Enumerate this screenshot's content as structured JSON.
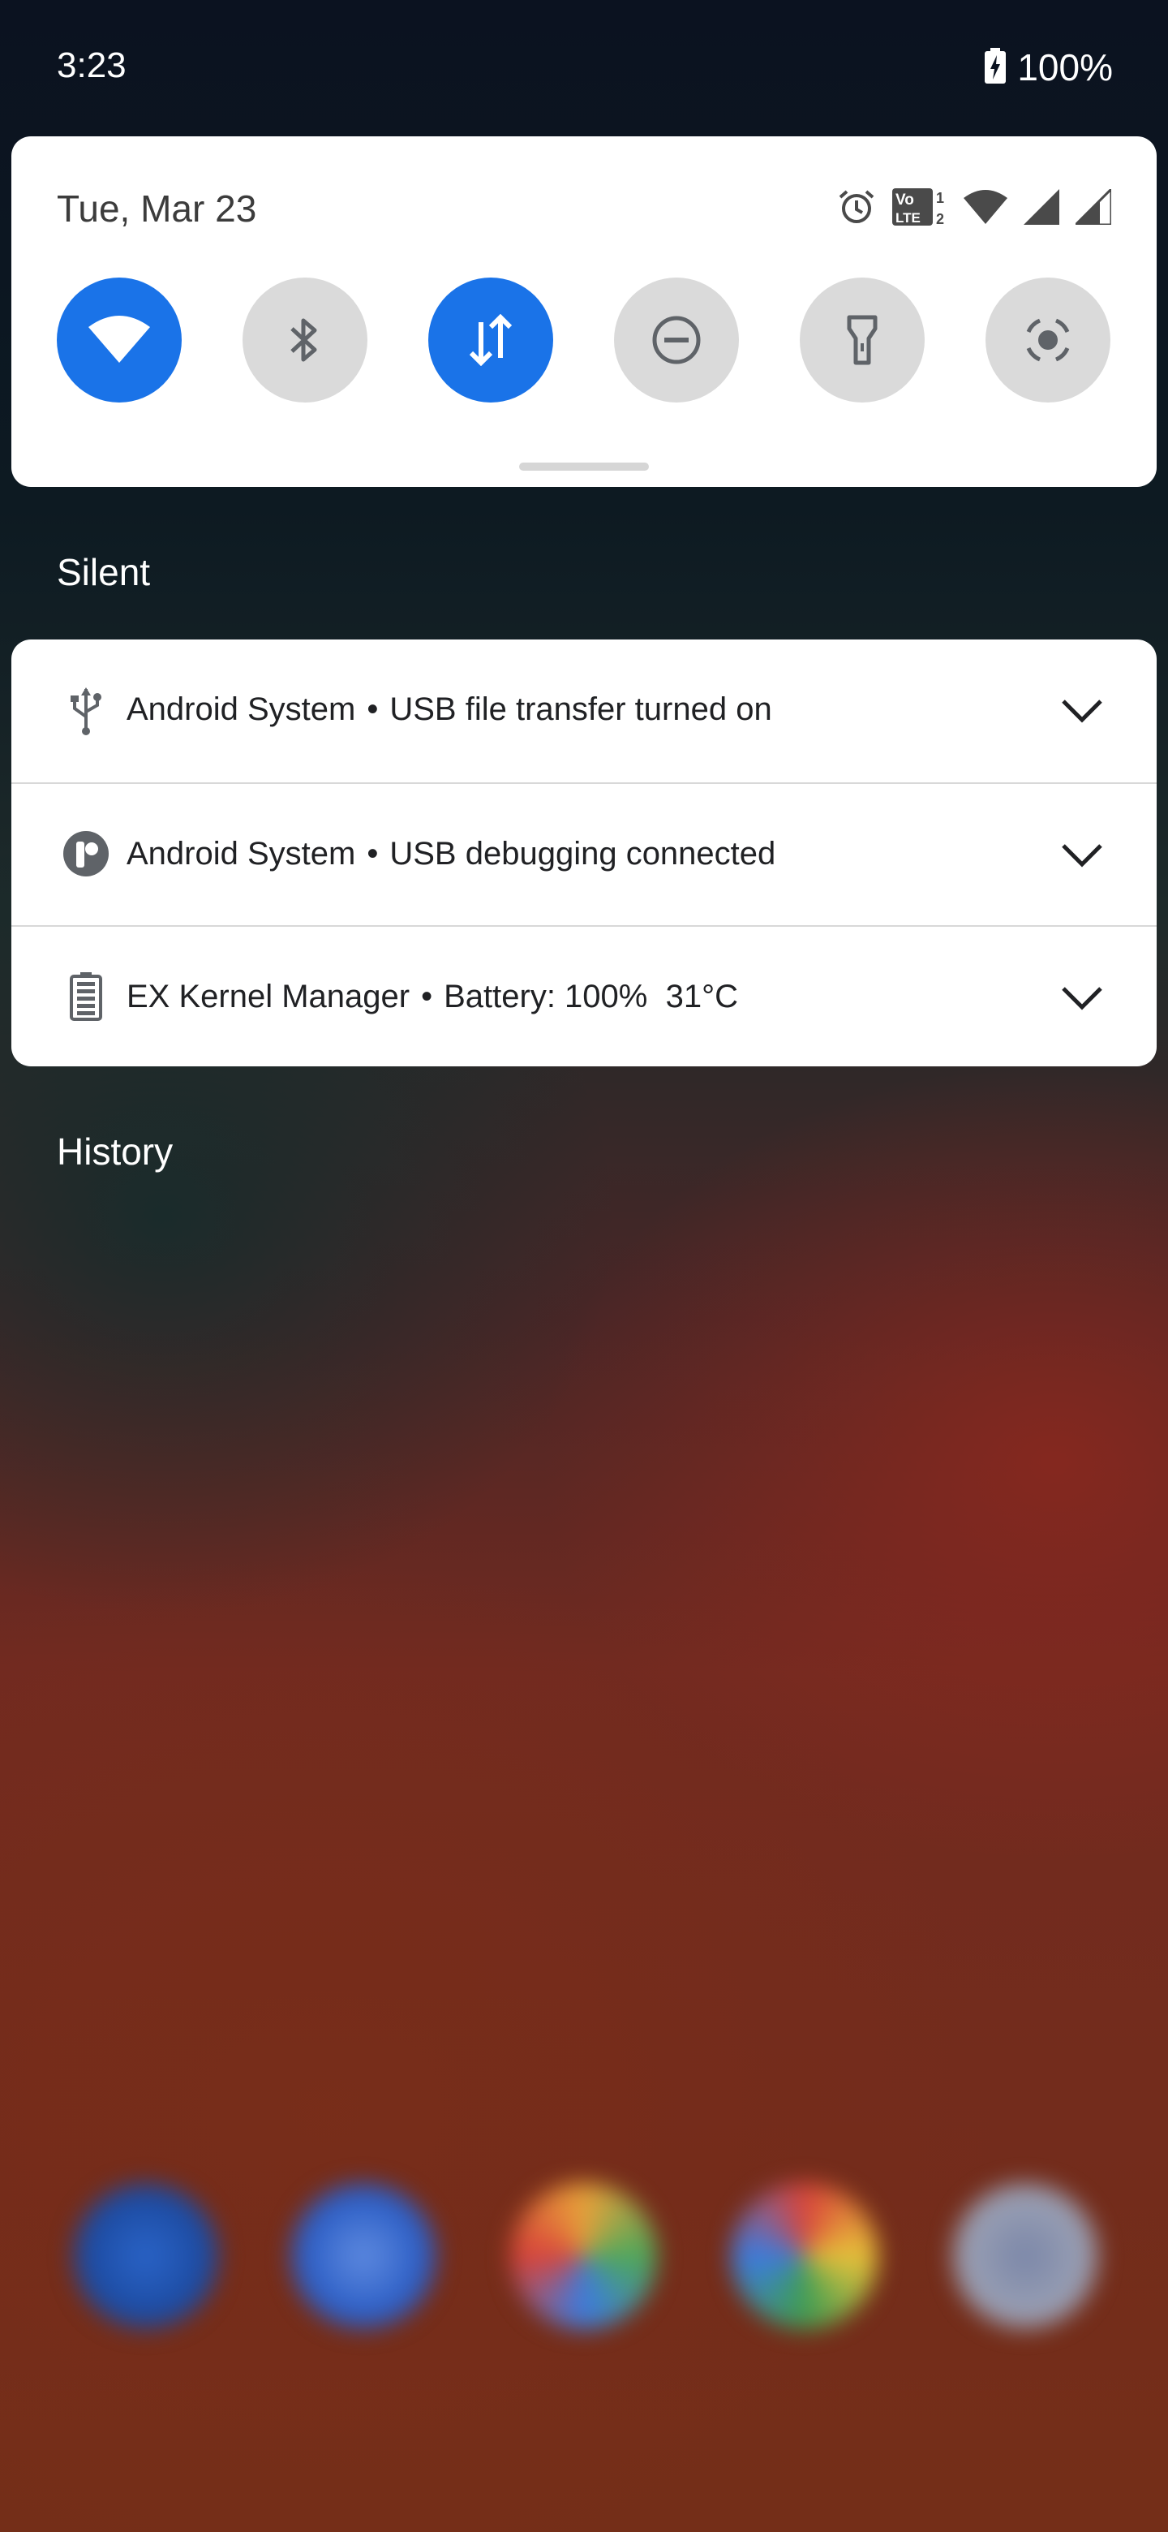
{
  "status_bar": {
    "time": "3:23",
    "battery": "100%"
  },
  "quick_settings": {
    "date": "Tue, Mar 23",
    "indicator_icons": [
      "alarm-icon",
      "volte-icon",
      "wifi-signal-icon",
      "cell-signal-icon",
      "cell-signal-icon"
    ],
    "volte_badge": {
      "top": "Vo",
      "sup": "1",
      "bottom": "LTE",
      "sub": "2"
    },
    "tiles": [
      {
        "name": "wifi",
        "active": true
      },
      {
        "name": "bluetooth",
        "active": false
      },
      {
        "name": "mobile-data",
        "active": true
      },
      {
        "name": "do-not-disturb",
        "active": false
      },
      {
        "name": "flashlight",
        "active": false
      },
      {
        "name": "auto-rotate",
        "active": false
      }
    ]
  },
  "sections": {
    "silent": "Silent",
    "history": "History"
  },
  "notifications": [
    {
      "icon": "usb-icon",
      "app": "Android System",
      "separator": "•",
      "text": "USB file transfer turned on"
    },
    {
      "icon": "adb-icon",
      "app": "Android System",
      "separator": "•",
      "text": "USB debugging connected"
    },
    {
      "icon": "battery-icon",
      "app": "EX Kernel Manager",
      "separator": "•",
      "text": "Battery: 100%  31°C"
    }
  ],
  "dock": {
    "icons": [
      "phone-app-icon",
      "messages-app-icon",
      "photos-app-icon",
      "chrome-app-icon",
      "camera-app-icon"
    ]
  },
  "colors": {
    "accent": "#1a73e8",
    "tile_off": "#dadada",
    "card_bg": "#ffffff"
  }
}
